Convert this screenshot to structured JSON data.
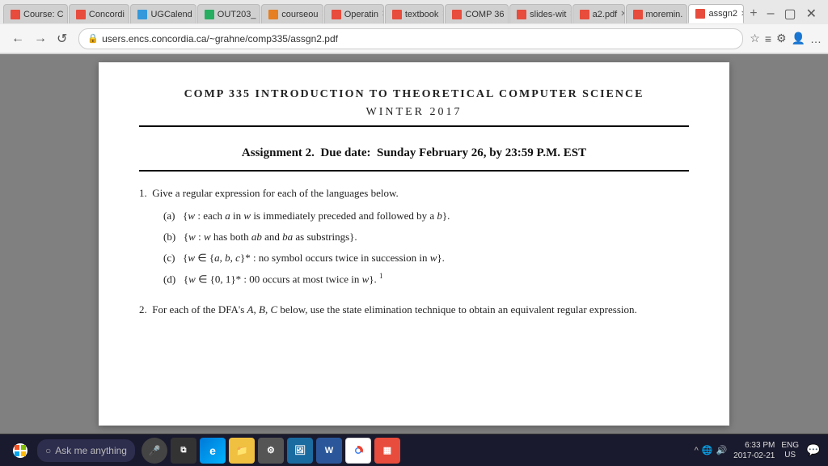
{
  "browser": {
    "tabs": [
      {
        "id": "tab1",
        "label": "Course: C",
        "favicon_color": "red",
        "active": false
      },
      {
        "id": "tab2",
        "label": "Concordi",
        "favicon_color": "red",
        "active": false
      },
      {
        "id": "tab3",
        "label": "UGCalend",
        "favicon_color": "blue",
        "active": false
      },
      {
        "id": "tab4",
        "label": "OUT203_",
        "favicon_color": "green",
        "active": false
      },
      {
        "id": "tab5",
        "label": "courseou",
        "favicon_color": "orange",
        "active": false
      },
      {
        "id": "tab6",
        "label": "Operatin",
        "favicon_color": "red",
        "active": false
      },
      {
        "id": "tab7",
        "label": "textbook",
        "favicon_color": "red",
        "active": false
      },
      {
        "id": "tab8",
        "label": "COMP 36",
        "favicon_color": "red",
        "active": false
      },
      {
        "id": "tab9",
        "label": "slides-wit",
        "favicon_color": "red",
        "active": false
      },
      {
        "id": "tab10",
        "label": "a2.pdf",
        "favicon_color": "red",
        "active": false
      },
      {
        "id": "tab11",
        "label": "moremin.",
        "favicon_color": "red",
        "active": false
      },
      {
        "id": "tab12",
        "label": "assgn2",
        "favicon_color": "red",
        "active": true
      }
    ],
    "new_tab_label": "+",
    "window_controls": [
      "–",
      "▢",
      "✕"
    ],
    "address": "users.encs.concordia.ca/~grahne/comp335/assgn2.pdf",
    "nav_buttons": [
      "←",
      "→",
      "↺"
    ],
    "lock_symbol": "🔒"
  },
  "pdf": {
    "title_line1": "COMP 335 INTRODUCTION TO THEORETICAL COMPUTER SCIENCE",
    "title_partial": "COMP 335 INTRODUCTION TO THEORETICAL COMPUTER SCIEN",
    "subtitle": "Winter 2017",
    "assignment_heading": "Assignment 2.  Due date:  Sunday February 26, by 23:59 P.M. EST",
    "questions": [
      {
        "number": "1.",
        "text": "Give a regular expression for each of the languages below.",
        "subquestions": [
          {
            "label": "(a)",
            "text": "{w : each a in w is immediately preceded and followed by a b}."
          },
          {
            "label": "(b)",
            "text": "{w : w has both ab and ba as substrings}."
          },
          {
            "label": "(c)",
            "text": "{w ∈ {a, b, c}* : no symbol occurs twice in succession in w}."
          },
          {
            "label": "(d)",
            "text": "{w ∈ {0, 1}* : 00 occurs at most twice in w}. ¹"
          }
        ]
      },
      {
        "number": "2.",
        "text": "For each of the DFA's A, B, C below, use the state elimination technique to obtain an equivalent regular expression.",
        "subquestions": []
      }
    ]
  },
  "taskbar": {
    "search_placeholder": "Ask me anything",
    "time": "6:33 PM",
    "date": "2017-02-21",
    "date_display": "2017-02-21",
    "lang": "ENG",
    "region": "US"
  }
}
